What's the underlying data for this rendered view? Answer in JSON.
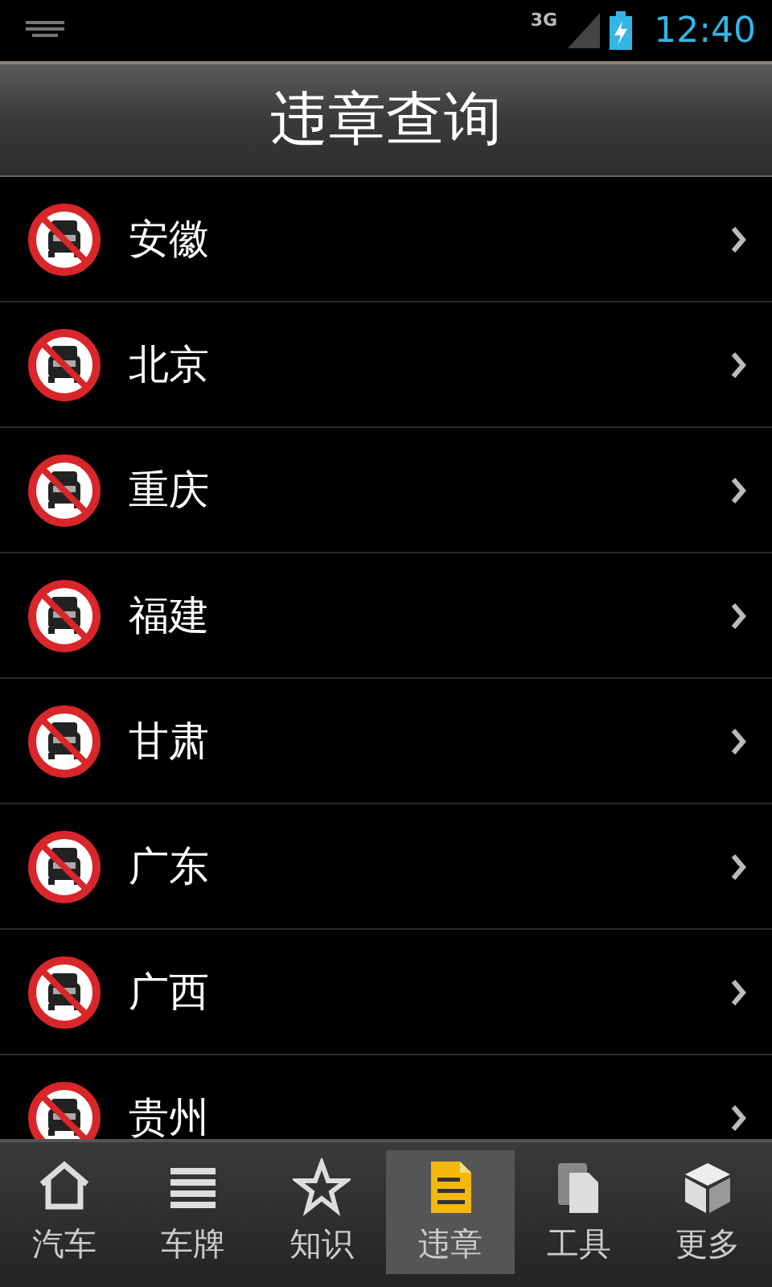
{
  "status_bar": {
    "network": "3G",
    "time": "12:40"
  },
  "header": {
    "title": "违章查询"
  },
  "provinces": [
    {
      "name": "安徽"
    },
    {
      "name": "北京"
    },
    {
      "name": "重庆"
    },
    {
      "name": "福建"
    },
    {
      "name": "甘肃"
    },
    {
      "name": "广东"
    },
    {
      "name": "广西"
    },
    {
      "name": "贵州"
    }
  ],
  "tabs": [
    {
      "label": "汽车",
      "kind": "home",
      "selected": false
    },
    {
      "label": "车牌",
      "kind": "list",
      "selected": false
    },
    {
      "label": "知识",
      "kind": "star",
      "selected": false
    },
    {
      "label": "违章",
      "kind": "document",
      "selected": true
    },
    {
      "label": "工具",
      "kind": "pages",
      "selected": false
    },
    {
      "label": "更多",
      "kind": "cube",
      "selected": false
    }
  ]
}
